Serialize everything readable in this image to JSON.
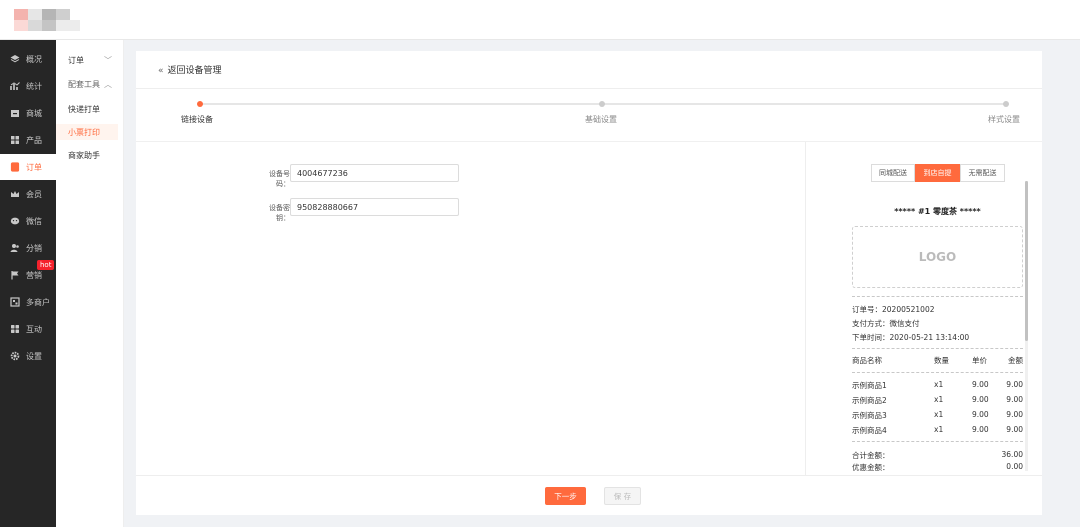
{
  "colors": {
    "accent": "#ff6a3d",
    "sidebar_bg": "#262626",
    "hot": "#f5222d"
  },
  "sidebar": {
    "items": [
      {
        "label": "概况",
        "icon": "layers-icon"
      },
      {
        "label": "统计",
        "icon": "chart-icon"
      },
      {
        "label": "商城",
        "icon": "store-icon"
      },
      {
        "label": "产品",
        "icon": "grid-icon"
      },
      {
        "label": "订单",
        "icon": "order-icon"
      },
      {
        "label": "会员",
        "icon": "crown-icon"
      },
      {
        "label": "微信",
        "icon": "wechat-icon"
      },
      {
        "label": "分销",
        "icon": "users-icon"
      },
      {
        "label": "营销",
        "icon": "flag-icon"
      },
      {
        "label": "多商户",
        "icon": "shop-icon"
      },
      {
        "label": "互动",
        "icon": "apps-icon"
      },
      {
        "label": "设置",
        "icon": "gear-icon"
      }
    ],
    "hot_badge": "hot"
  },
  "submenu": {
    "orders": "订单",
    "tools_group": "配套工具",
    "quick_print": "快递打单",
    "receipt_print": "小票打印",
    "merchant_helper": "商家助手"
  },
  "header": {
    "back_label": "返回设备管理"
  },
  "steps": [
    {
      "label": "链接设备"
    },
    {
      "label": "基础设置"
    },
    {
      "label": "样式设置"
    }
  ],
  "form": {
    "device_no_label": "设备号码：",
    "device_no_value": "4004677236",
    "device_key_label": "设备密钥：",
    "device_key_value": "950828880667"
  },
  "preview": {
    "tabs": [
      "同城配送",
      "到店自提",
      "无需配送"
    ],
    "receipt": {
      "title": "***** #1 零度茶 *****",
      "logo_text": "LOGO",
      "order_no": "订单号：20200521002",
      "pay_method": "支付方式：微信支付",
      "order_time": "下单时间：2020-05-21 13:14:00",
      "columns": [
        "商品名称",
        "数量",
        "单价",
        "金额"
      ],
      "items": [
        {
          "name": "示例商品1",
          "qty": "x1",
          "price": "9.00",
          "amount": "9.00"
        },
        {
          "name": "示例商品2",
          "qty": "x1",
          "price": "9.00",
          "amount": "9.00"
        },
        {
          "name": "示例商品3",
          "qty": "x1",
          "price": "9.00",
          "amount": "9.00"
        },
        {
          "name": "示例商品4",
          "qty": "x1",
          "price": "9.00",
          "amount": "9.00"
        }
      ],
      "total_label": "合计金额：",
      "total_value": "36.00",
      "discount_label": "优惠金额：",
      "discount_value": "0.00"
    }
  },
  "footer": {
    "next_label": "下一步",
    "save_label": "保 存"
  }
}
